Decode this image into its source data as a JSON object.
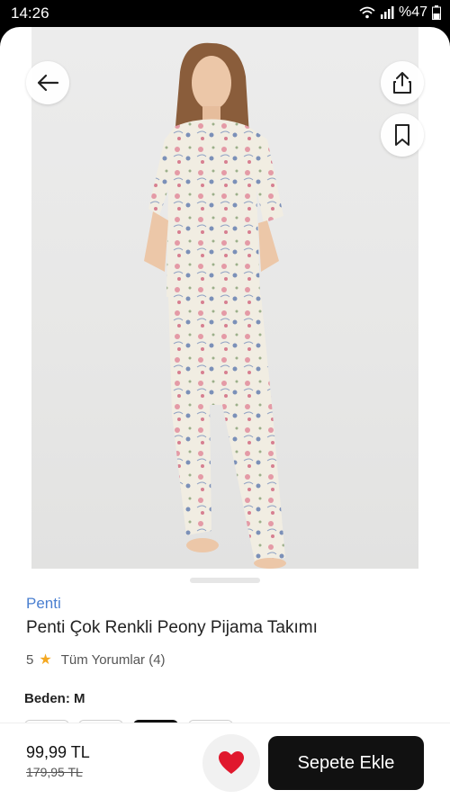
{
  "status_bar": {
    "time": "14:26",
    "battery": "%47"
  },
  "product": {
    "brand": "Penti",
    "title": "Penti Çok Renkli Peony Pijama Takımı",
    "rating": "5",
    "reviews_label": "Tüm Yorumlar (4)",
    "size_label": "Beden: M"
  },
  "purchase": {
    "price": "99,99 TL",
    "old_price": "179,95 TL",
    "add_to_cart_label": "Sepete Ekle"
  },
  "icons": [
    "back-arrow-icon",
    "share-icon",
    "bookmark-icon",
    "heart-icon",
    "star-icon",
    "wifi-icon",
    "signal-icon",
    "battery-icon"
  ],
  "colors": {
    "brand": "#4a7fd0",
    "star": "#f4a821",
    "heart": "#e0182d",
    "cart_button": "#111111"
  }
}
